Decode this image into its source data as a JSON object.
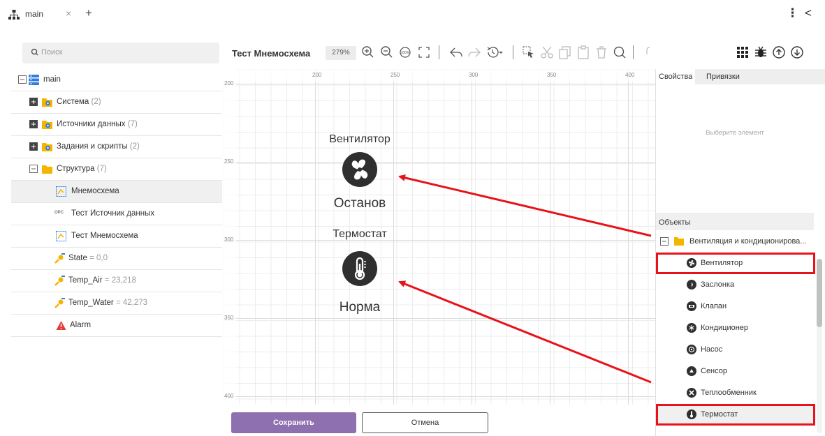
{
  "titlebar": {
    "tab_label": "main",
    "close_glyph": "×",
    "add_glyph": "+",
    "more_glyph": "⋮",
    "back_glyph": "<"
  },
  "sidebar": {
    "search_placeholder": "Поиск",
    "root_label": "main",
    "items": [
      {
        "label": "Система",
        "count": "(2)"
      },
      {
        "label": "Источники данных",
        "count": "(7)"
      },
      {
        "label": "Задания и скрипты",
        "count": "(2)"
      },
      {
        "label": "Структура",
        "count": "(7)"
      },
      {
        "label": "Мнемосхема"
      },
      {
        "label": "Тест Источник данных",
        "prefix": "OPC"
      },
      {
        "label": "Тест Мнемосхема"
      },
      {
        "label": "State",
        "value": "= 0,0"
      },
      {
        "label": "Temp_Air",
        "value": "= 23,218"
      },
      {
        "label": "Temp_Water",
        "value": "= 42,273"
      },
      {
        "label": "Alarm"
      }
    ]
  },
  "editor": {
    "title": "Тест Мнемосхема",
    "zoom": "279%",
    "icons": [
      "zoom-in-icon",
      "zoom-out-icon",
      "zoom-100-icon",
      "fit-screen-icon",
      "undo-icon",
      "redo-icon",
      "history-icon",
      "select-icon",
      "cut-icon",
      "copy-icon",
      "paste-icon",
      "delete-icon",
      "search-icon",
      "grid-icon",
      "debug-icon",
      "upload-icon",
      "download-icon"
    ],
    "ruler_x": [
      "200",
      "250",
      "300",
      "350",
      "400"
    ],
    "ruler_y": [
      "200",
      "250",
      "300",
      "350",
      "400"
    ],
    "elements": {
      "fan_caption": "Вентилятор",
      "fan_status": "Останов",
      "thermo_caption": "Термостат",
      "thermo_status": "Норма"
    },
    "save_label": "Сохранить",
    "cancel_label": "Отмена"
  },
  "properties": {
    "tab_props": "Свойства",
    "tab_bindings": "Привязки",
    "empty_hint": "Выберите элемент",
    "objects_header": "Объекты",
    "group_label": "Вентиляция и кондиционирова...",
    "objects": [
      "Вентилятор",
      "Заслонка",
      "Клапан",
      "Кондиционер",
      "Насос",
      "Сенсор",
      "Теплообменник",
      "Термостат"
    ]
  },
  "colors": {
    "accent": "#8e6fb0",
    "highlight": "#e8131a",
    "folder": "#f5b400",
    "alarm": "#e53935"
  }
}
